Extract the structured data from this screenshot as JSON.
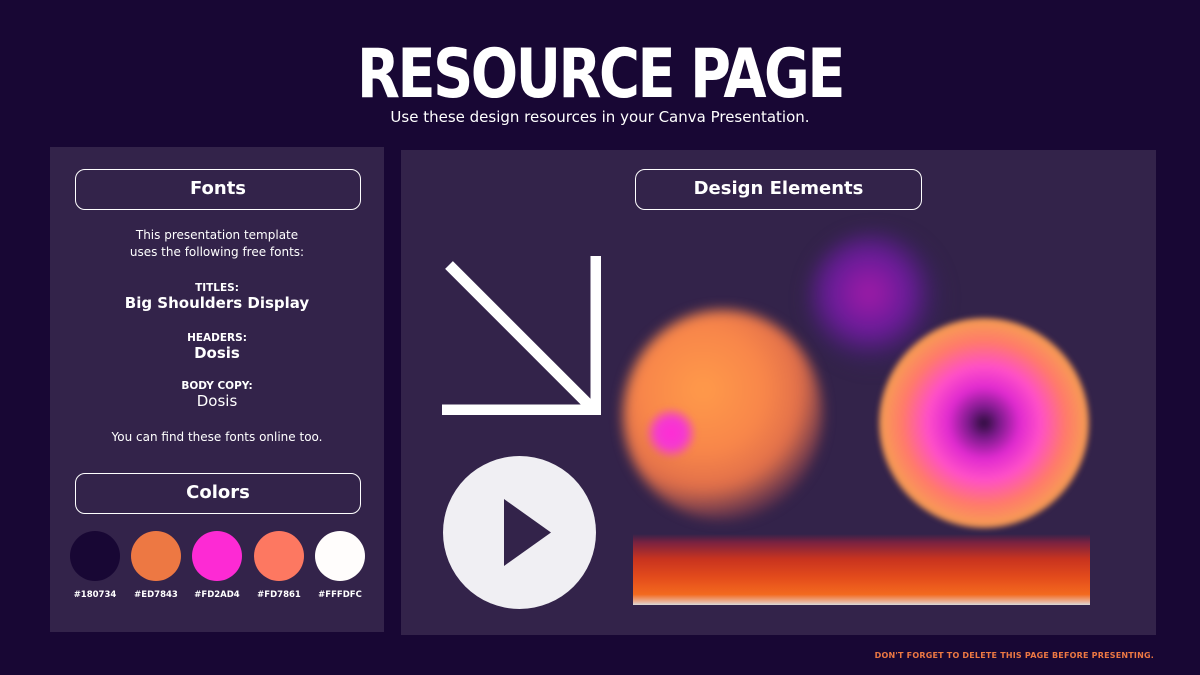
{
  "header": {
    "title": "RESOURCE PAGE",
    "subtitle": "Use these design resources in your Canva Presentation."
  },
  "fonts_panel": {
    "heading": "Fonts",
    "intro_line1": "This presentation template",
    "intro_line2": "uses the following free fonts:",
    "titles_label": "TITLES:",
    "titles_value": "Big Shoulders Display",
    "headers_label": "HEADERS:",
    "headers_value": "Dosis",
    "body_label": "BODY COPY:",
    "body_value": "Dosis",
    "outro": "You can find these fonts online too."
  },
  "colors_panel": {
    "heading": "Colors",
    "swatches": [
      {
        "hex": "#180734",
        "color": "#180734"
      },
      {
        "hex": "#ED7843",
        "color": "#ED7843"
      },
      {
        "hex": "#FD2AD4",
        "color": "#FD2AD4"
      },
      {
        "hex": "#FD7861",
        "color": "#FD7861"
      },
      {
        "hex": "#FFFDFC",
        "color": "#FFFDFC"
      }
    ]
  },
  "design_panel": {
    "heading": "Design Elements",
    "elements": [
      "diagonal-arrow-icon",
      "play-button-icon",
      "purple-blur",
      "orange-blur",
      "pink-ring-blur",
      "gradient-bar"
    ]
  },
  "footer": {
    "note": "DON'T FORGET TO DELETE THIS PAGE BEFORE PRESENTING."
  },
  "colors": {
    "background": "#180734",
    "panel": "#33234a",
    "accent_orange": "#ED7843",
    "accent_pink": "#FD2AD4"
  }
}
